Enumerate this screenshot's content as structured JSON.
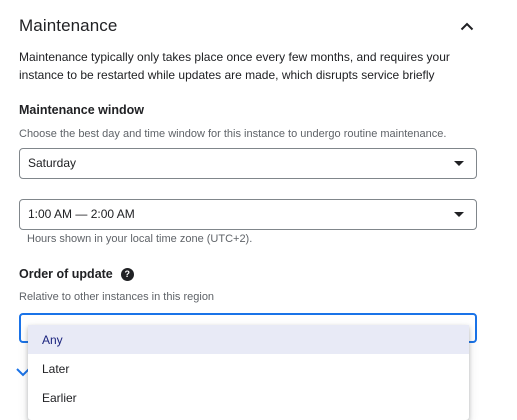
{
  "section": {
    "title": "Maintenance",
    "description": "Maintenance typically only takes place once every few months, and requires your instance to be restarted while updates are made, which disrupts service briefly"
  },
  "maintenance_window": {
    "label": "Maintenance window",
    "help": "Choose the best day and time window for this instance to undergo routine maintenance.",
    "day_value": "Saturday",
    "time_value": "1:00 AM — 2:00 AM",
    "time_hint": "Hours shown in your local time zone (UTC+2)."
  },
  "order_of_update": {
    "label": "Order of update",
    "help_icon_glyph": "?",
    "help": "Relative to other instances in this region",
    "selected_value": "",
    "options": [
      "Any",
      "Later",
      "Earlier"
    ]
  }
}
